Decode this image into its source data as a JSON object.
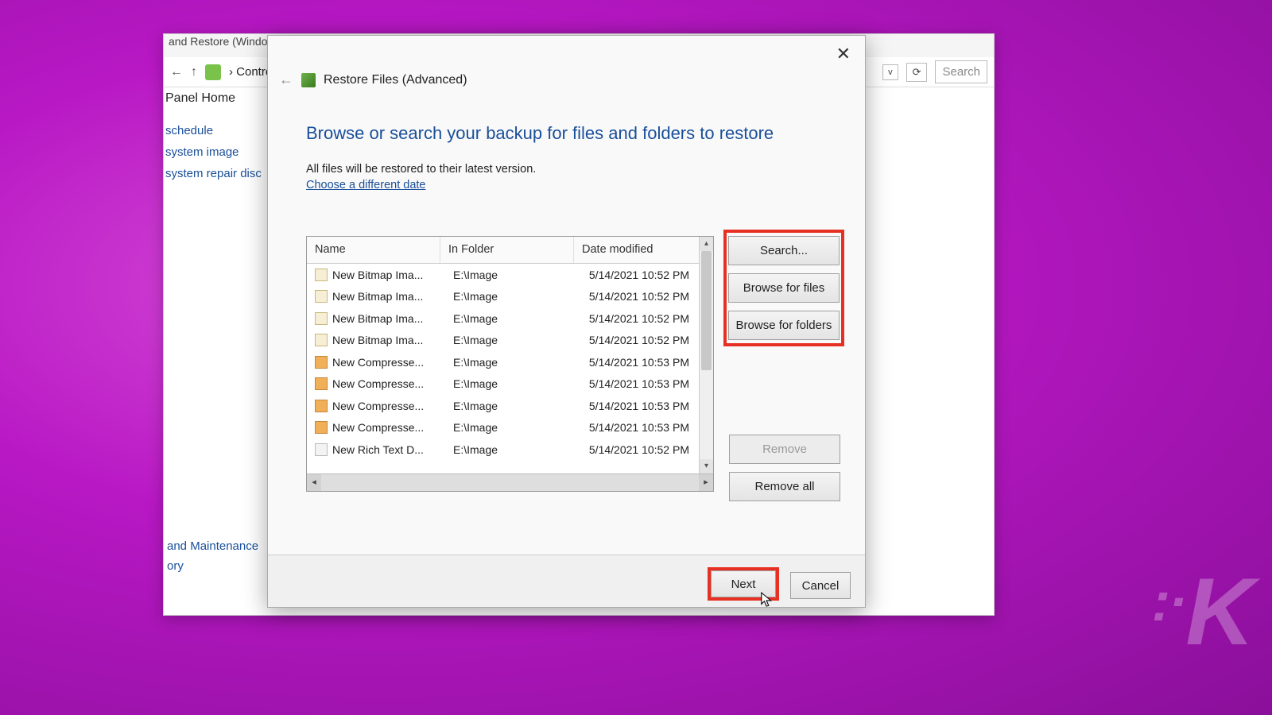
{
  "bg": {
    "title": "and Restore (Window…",
    "breadcrumb": "›  Contro…",
    "search_placeholder": "Search",
    "sidebar": {
      "home": "Panel Home",
      "items": [
        "schedule",
        "system image",
        "system repair disc"
      ],
      "bottom": [
        "and Maintenance",
        "ory"
      ]
    }
  },
  "dialog": {
    "title": "Restore Files (Advanced)",
    "heading": "Browse or search your backup for files and folders to restore",
    "subtext": "All files will be restored to their latest version.",
    "link": "Choose a different date",
    "columns": {
      "name": "Name",
      "folder": "In Folder",
      "date": "Date modified"
    },
    "rows": [
      {
        "icon": "bmp",
        "name": "New Bitmap Ima...",
        "folder": "E:\\Image",
        "date": "5/14/2021 10:52 PM"
      },
      {
        "icon": "bmp",
        "name": "New Bitmap Ima...",
        "folder": "E:\\Image",
        "date": "5/14/2021 10:52 PM"
      },
      {
        "icon": "bmp",
        "name": "New Bitmap Ima...",
        "folder": "E:\\Image",
        "date": "5/14/2021 10:52 PM"
      },
      {
        "icon": "bmp",
        "name": "New Bitmap Ima...",
        "folder": "E:\\Image",
        "date": "5/14/2021 10:52 PM"
      },
      {
        "icon": "zip",
        "name": "New Compresse...",
        "folder": "E:\\Image",
        "date": "5/14/2021 10:53 PM"
      },
      {
        "icon": "zip",
        "name": "New Compresse...",
        "folder": "E:\\Image",
        "date": "5/14/2021 10:53 PM"
      },
      {
        "icon": "zip",
        "name": "New Compresse...",
        "folder": "E:\\Image",
        "date": "5/14/2021 10:53 PM"
      },
      {
        "icon": "zip",
        "name": "New Compresse...",
        "folder": "E:\\Image",
        "date": "5/14/2021 10:53 PM"
      },
      {
        "icon": "txt",
        "name": "New Rich Text D...",
        "folder": "E:\\Image",
        "date": "5/14/2021 10:52 PM"
      }
    ],
    "buttons": {
      "search": "Search...",
      "browse_files": "Browse for files",
      "browse_folders": "Browse for folders",
      "remove": "Remove",
      "remove_all": "Remove all",
      "next": "Next",
      "cancel": "Cancel"
    }
  },
  "watermark": "K"
}
